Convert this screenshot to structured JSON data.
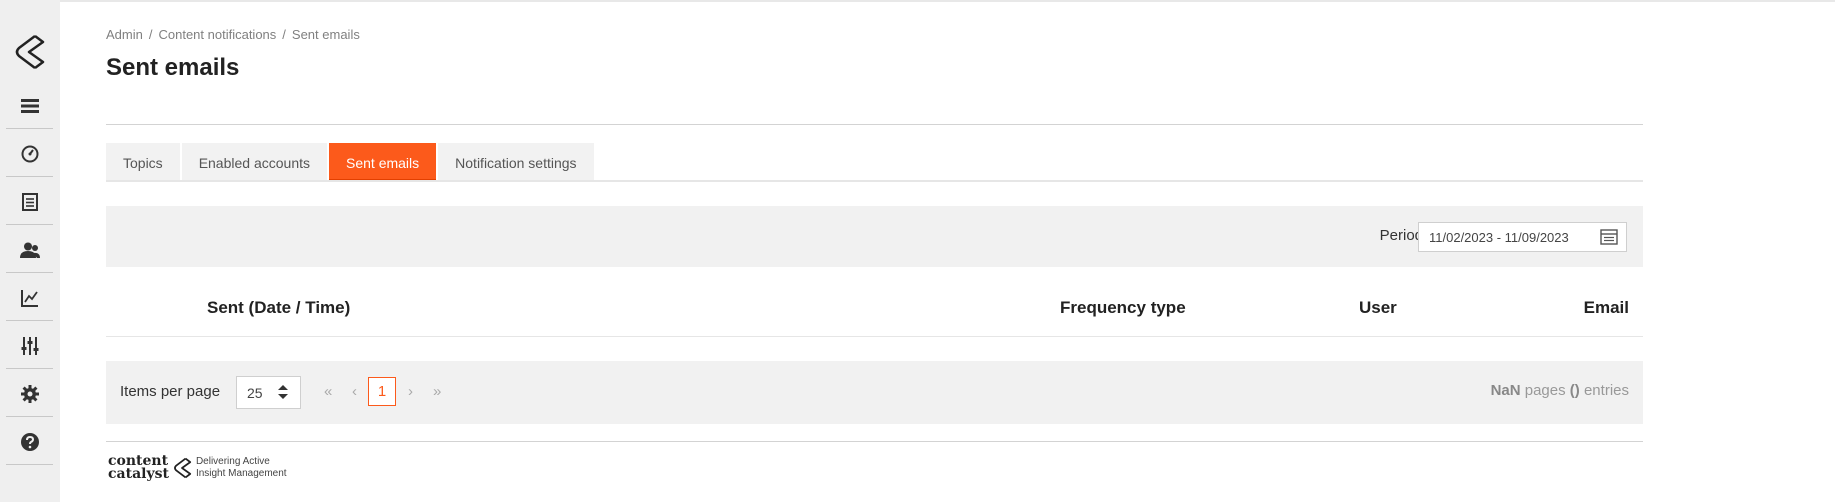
{
  "sidebar": {
    "items": [
      {
        "icon": "menu-icon"
      },
      {
        "icon": "dashboard-icon"
      },
      {
        "icon": "document-icon"
      },
      {
        "icon": "users-icon"
      },
      {
        "icon": "chart-icon"
      },
      {
        "icon": "sliders-icon"
      },
      {
        "icon": "gear-icon"
      },
      {
        "icon": "help-icon"
      }
    ]
  },
  "breadcrumb": {
    "items": [
      "Admin",
      "Content notifications",
      "Sent emails"
    ],
    "separator": "/"
  },
  "page_title": "Sent emails",
  "tabs": [
    {
      "label": "Topics",
      "active": false
    },
    {
      "label": "Enabled accounts",
      "active": false
    },
    {
      "label": "Sent emails",
      "active": true
    },
    {
      "label": "Notification settings",
      "active": false
    }
  ],
  "filter": {
    "period_label": "Period",
    "period_value": "11/02/2023 - 11/09/2023"
  },
  "table": {
    "columns": [
      "Sent (Date / Time)",
      "Frequency type",
      "User",
      "Email"
    ],
    "rows": []
  },
  "pagination": {
    "items_per_page_label": "Items per page",
    "items_per_page": "25",
    "first": "«",
    "prev": "‹",
    "current_page": "1",
    "next": "›",
    "last": "»",
    "pages_count": "NaN",
    "pages_word": "pages",
    "entries_count": "()",
    "entries_word": "entries"
  },
  "footer": {
    "brand_line1": "content",
    "brand_line2": "catalyst",
    "tagline_line1": "Delivering Active",
    "tagline_line2": "Insight Management"
  },
  "colors": {
    "accent": "#fc5a1b",
    "sidebar_bg": "#efefef",
    "panel_bg": "#f1f1f1"
  }
}
